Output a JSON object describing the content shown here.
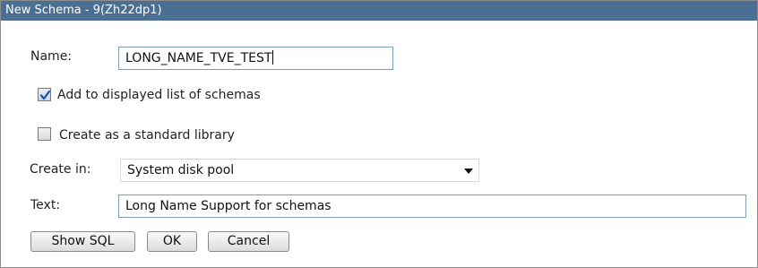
{
  "window": {
    "title": "New Schema - 9(Zh22dp1)"
  },
  "form": {
    "name_label": "Name:",
    "name_value": "LONG_NAME_TVE_TEST",
    "add_to_list": {
      "label": "Add to displayed list of schemas",
      "checked": true
    },
    "standard_library": {
      "label": "Create as a standard library",
      "checked": false
    },
    "create_in_label": "Create in:",
    "create_in_value": "System disk pool",
    "text_label": "Text:",
    "text_value": "Long Name Support for schemas"
  },
  "buttons": {
    "show_sql": "Show SQL",
    "ok": "OK",
    "cancel": "Cancel"
  },
  "icons": {
    "checkmark": "checkmark-icon",
    "dropdown": "chevron-down-icon"
  },
  "colors": {
    "titlebar": "#4b6f92",
    "checkmark": "#1f4fa3"
  }
}
